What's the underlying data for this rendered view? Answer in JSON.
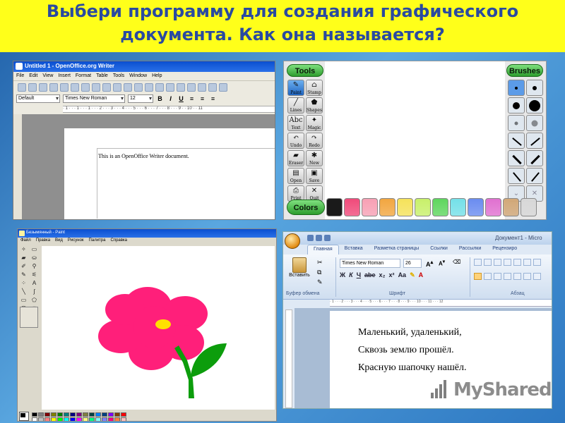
{
  "slide": {
    "title_line1": "Выбери программу для создания графического",
    "title_line2": "документа. Как она называется?"
  },
  "writer": {
    "window_title": "Untitled 1 - OpenOffice.org Writer",
    "menu": [
      "File",
      "Edit",
      "View",
      "Insert",
      "Format",
      "Table",
      "Tools",
      "Window",
      "Help"
    ],
    "style": "Default",
    "font": "Times New Roman",
    "size": "12",
    "ruler": "· 1 · · · 1 · · · 1 · · · 2 · · · 3 · · · 4 · · · 5 · · · 6 · · · 7 · · · 8 · · · 9 · · 10 · · 11",
    "document_text": "This is an OpenOffice Writer document."
  },
  "tuxpaint": {
    "tools_label": "Tools",
    "brushes_label": "Brushes",
    "colors_label": "Colors",
    "tools": [
      {
        "label": "Paint",
        "icon": "paintbrush-icon",
        "glyph": "✎"
      },
      {
        "label": "Stamp",
        "icon": "stamp-icon",
        "glyph": "⌂"
      },
      {
        "label": "Lines",
        "icon": "lines-icon",
        "glyph": "╱"
      },
      {
        "label": "Shapes",
        "icon": "shapes-icon",
        "glyph": "⬟"
      },
      {
        "label": "Text",
        "icon": "text-icon",
        "glyph": "Abc"
      },
      {
        "label": "Magic",
        "icon": "magic-wand-icon",
        "glyph": "✦"
      },
      {
        "label": "Undo",
        "icon": "undo-icon",
        "glyph": "↶"
      },
      {
        "label": "Redo",
        "icon": "redo-icon",
        "glyph": "↷"
      },
      {
        "label": "Eraser",
        "icon": "eraser-icon",
        "glyph": "▰"
      },
      {
        "label": "New",
        "icon": "new-page-icon",
        "glyph": "✱"
      },
      {
        "label": "Open",
        "icon": "open-icon",
        "glyph": "▤"
      },
      {
        "label": "Save",
        "icon": "save-icon",
        "glyph": "▣"
      },
      {
        "label": "Print",
        "icon": "print-icon",
        "glyph": "⎙"
      },
      {
        "label": "Quit",
        "icon": "quit-icon",
        "glyph": "✕"
      }
    ],
    "colors": [
      "#1a1a1a",
      "#f04a7a",
      "#f7a0b4",
      "#f2a640",
      "#f5e25a",
      "#c8f06a",
      "#5ed65e",
      "#74e0e8",
      "#6a8cf0",
      "#e070d0",
      "#d2a878",
      "#d8d8d8"
    ]
  },
  "paint": {
    "window_title": "Безымянный - Paint",
    "menu": [
      "Файл",
      "Правка",
      "Вид",
      "Рисунок",
      "Палитра",
      "Справка"
    ],
    "palette": [
      "#000000",
      "#808080",
      "#800000",
      "#808000",
      "#008000",
      "#008080",
      "#000080",
      "#800080",
      "#808040",
      "#004040",
      "#0080ff",
      "#004080",
      "#8000ff",
      "#804000",
      "#ff0000",
      "#ffffff",
      "#c0c0c0",
      "#ff8080",
      "#ffff00",
      "#00ff00",
      "#00ffff",
      "#0000ff",
      "#ff00ff",
      "#ffff80",
      "#00ff80",
      "#80ffff",
      "#8080ff",
      "#ff0080",
      "#ff8040",
      "#ffc0c0"
    ]
  },
  "word": {
    "doc_title": "Документ1 - Micro",
    "tabs": [
      "Главная",
      "Вставка",
      "Разметка страницы",
      "Ссылки",
      "Рассылки",
      "Рецензиро"
    ],
    "paste_label": "Вставить",
    "font": "Times New Roman",
    "size": "26",
    "group_clipboard": "Буфер обмена",
    "group_font": "Шрифт",
    "group_paragraph": "Абзац",
    "lines": [
      "Маленький, удаленький,",
      "Сквозь землю прошёл.",
      "Красную шапочку нашёл."
    ]
  },
  "watermark": {
    "text": "MyShared"
  }
}
